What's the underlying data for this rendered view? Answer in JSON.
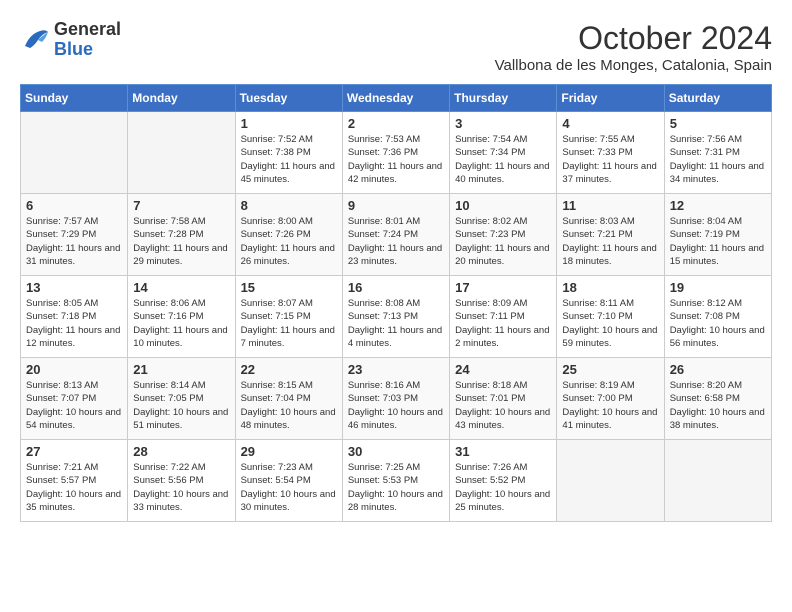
{
  "header": {
    "logo_general": "General",
    "logo_blue": "Blue",
    "month_year": "October 2024",
    "location": "Vallbona de les Monges, Catalonia, Spain"
  },
  "days_of_week": [
    "Sunday",
    "Monday",
    "Tuesday",
    "Wednesday",
    "Thursday",
    "Friday",
    "Saturday"
  ],
  "weeks": [
    [
      {
        "day": "",
        "empty": true
      },
      {
        "day": "",
        "empty": true
      },
      {
        "day": "1",
        "sunrise": "Sunrise: 7:52 AM",
        "sunset": "Sunset: 7:38 PM",
        "daylight": "Daylight: 11 hours and 45 minutes."
      },
      {
        "day": "2",
        "sunrise": "Sunrise: 7:53 AM",
        "sunset": "Sunset: 7:36 PM",
        "daylight": "Daylight: 11 hours and 42 minutes."
      },
      {
        "day": "3",
        "sunrise": "Sunrise: 7:54 AM",
        "sunset": "Sunset: 7:34 PM",
        "daylight": "Daylight: 11 hours and 40 minutes."
      },
      {
        "day": "4",
        "sunrise": "Sunrise: 7:55 AM",
        "sunset": "Sunset: 7:33 PM",
        "daylight": "Daylight: 11 hours and 37 minutes."
      },
      {
        "day": "5",
        "sunrise": "Sunrise: 7:56 AM",
        "sunset": "Sunset: 7:31 PM",
        "daylight": "Daylight: 11 hours and 34 minutes."
      }
    ],
    [
      {
        "day": "6",
        "sunrise": "Sunrise: 7:57 AM",
        "sunset": "Sunset: 7:29 PM",
        "daylight": "Daylight: 11 hours and 31 minutes."
      },
      {
        "day": "7",
        "sunrise": "Sunrise: 7:58 AM",
        "sunset": "Sunset: 7:28 PM",
        "daylight": "Daylight: 11 hours and 29 minutes."
      },
      {
        "day": "8",
        "sunrise": "Sunrise: 8:00 AM",
        "sunset": "Sunset: 7:26 PM",
        "daylight": "Daylight: 11 hours and 26 minutes."
      },
      {
        "day": "9",
        "sunrise": "Sunrise: 8:01 AM",
        "sunset": "Sunset: 7:24 PM",
        "daylight": "Daylight: 11 hours and 23 minutes."
      },
      {
        "day": "10",
        "sunrise": "Sunrise: 8:02 AM",
        "sunset": "Sunset: 7:23 PM",
        "daylight": "Daylight: 11 hours and 20 minutes."
      },
      {
        "day": "11",
        "sunrise": "Sunrise: 8:03 AM",
        "sunset": "Sunset: 7:21 PM",
        "daylight": "Daylight: 11 hours and 18 minutes."
      },
      {
        "day": "12",
        "sunrise": "Sunrise: 8:04 AM",
        "sunset": "Sunset: 7:19 PM",
        "daylight": "Daylight: 11 hours and 15 minutes."
      }
    ],
    [
      {
        "day": "13",
        "sunrise": "Sunrise: 8:05 AM",
        "sunset": "Sunset: 7:18 PM",
        "daylight": "Daylight: 11 hours and 12 minutes."
      },
      {
        "day": "14",
        "sunrise": "Sunrise: 8:06 AM",
        "sunset": "Sunset: 7:16 PM",
        "daylight": "Daylight: 11 hours and 10 minutes."
      },
      {
        "day": "15",
        "sunrise": "Sunrise: 8:07 AM",
        "sunset": "Sunset: 7:15 PM",
        "daylight": "Daylight: 11 hours and 7 minutes."
      },
      {
        "day": "16",
        "sunrise": "Sunrise: 8:08 AM",
        "sunset": "Sunset: 7:13 PM",
        "daylight": "Daylight: 11 hours and 4 minutes."
      },
      {
        "day": "17",
        "sunrise": "Sunrise: 8:09 AM",
        "sunset": "Sunset: 7:11 PM",
        "daylight": "Daylight: 11 hours and 2 minutes."
      },
      {
        "day": "18",
        "sunrise": "Sunrise: 8:11 AM",
        "sunset": "Sunset: 7:10 PM",
        "daylight": "Daylight: 10 hours and 59 minutes."
      },
      {
        "day": "19",
        "sunrise": "Sunrise: 8:12 AM",
        "sunset": "Sunset: 7:08 PM",
        "daylight": "Daylight: 10 hours and 56 minutes."
      }
    ],
    [
      {
        "day": "20",
        "sunrise": "Sunrise: 8:13 AM",
        "sunset": "Sunset: 7:07 PM",
        "daylight": "Daylight: 10 hours and 54 minutes."
      },
      {
        "day": "21",
        "sunrise": "Sunrise: 8:14 AM",
        "sunset": "Sunset: 7:05 PM",
        "daylight": "Daylight: 10 hours and 51 minutes."
      },
      {
        "day": "22",
        "sunrise": "Sunrise: 8:15 AM",
        "sunset": "Sunset: 7:04 PM",
        "daylight": "Daylight: 10 hours and 48 minutes."
      },
      {
        "day": "23",
        "sunrise": "Sunrise: 8:16 AM",
        "sunset": "Sunset: 7:03 PM",
        "daylight": "Daylight: 10 hours and 46 minutes."
      },
      {
        "day": "24",
        "sunrise": "Sunrise: 8:18 AM",
        "sunset": "Sunset: 7:01 PM",
        "daylight": "Daylight: 10 hours and 43 minutes."
      },
      {
        "day": "25",
        "sunrise": "Sunrise: 8:19 AM",
        "sunset": "Sunset: 7:00 PM",
        "daylight": "Daylight: 10 hours and 41 minutes."
      },
      {
        "day": "26",
        "sunrise": "Sunrise: 8:20 AM",
        "sunset": "Sunset: 6:58 PM",
        "daylight": "Daylight: 10 hours and 38 minutes."
      }
    ],
    [
      {
        "day": "27",
        "sunrise": "Sunrise: 7:21 AM",
        "sunset": "Sunset: 5:57 PM",
        "daylight": "Daylight: 10 hours and 35 minutes."
      },
      {
        "day": "28",
        "sunrise": "Sunrise: 7:22 AM",
        "sunset": "Sunset: 5:56 PM",
        "daylight": "Daylight: 10 hours and 33 minutes."
      },
      {
        "day": "29",
        "sunrise": "Sunrise: 7:23 AM",
        "sunset": "Sunset: 5:54 PM",
        "daylight": "Daylight: 10 hours and 30 minutes."
      },
      {
        "day": "30",
        "sunrise": "Sunrise: 7:25 AM",
        "sunset": "Sunset: 5:53 PM",
        "daylight": "Daylight: 10 hours and 28 minutes."
      },
      {
        "day": "31",
        "sunrise": "Sunrise: 7:26 AM",
        "sunset": "Sunset: 5:52 PM",
        "daylight": "Daylight: 10 hours and 25 minutes."
      },
      {
        "day": "",
        "empty": true
      },
      {
        "day": "",
        "empty": true
      }
    ]
  ]
}
